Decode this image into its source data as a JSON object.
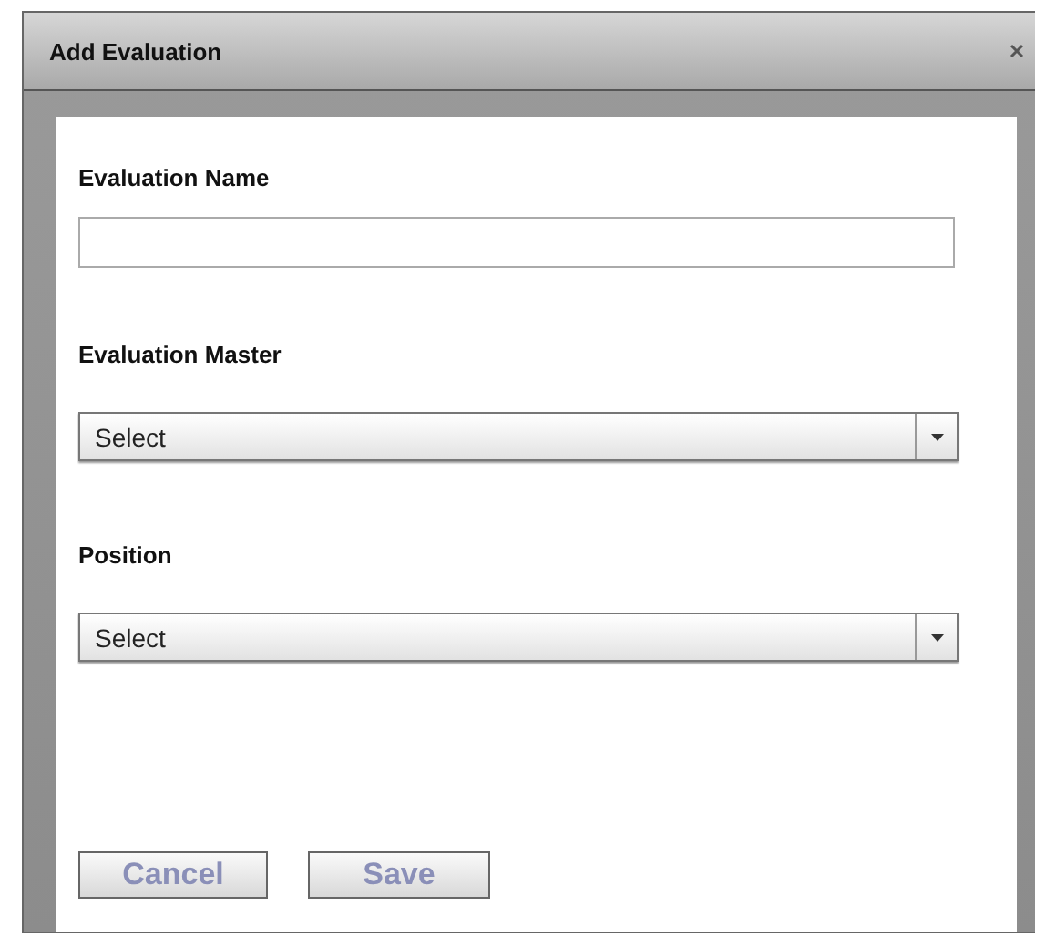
{
  "window": {
    "title": "Add Evaluation"
  },
  "fields": [
    {
      "kind": "text",
      "label": "Evaluation Name"
    },
    {
      "kind": "select",
      "label": "Evaluation Master",
      "value": "Select"
    },
    {
      "kind": "select",
      "label": "Position",
      "value": "Select"
    }
  ],
  "buttons": [
    "Cancel",
    "Save"
  ]
}
